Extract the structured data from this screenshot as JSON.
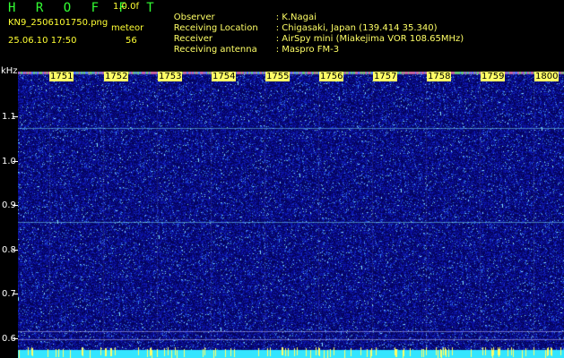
{
  "header": {
    "logo": "H R O F F T",
    "version": "1.0.0f",
    "filename": "KN9_2506101750.png",
    "datetime": "25.06.10 17:50",
    "meteor_label": "meteor",
    "meteor_count": "56",
    "info": [
      {
        "key": "Observer",
        "value": ": K.Nagai"
      },
      {
        "key": "Receiving Location",
        "value": ": Chigasaki, Japan (139.414 35.340)"
      },
      {
        "key": "Receiver",
        "value": ": AirSpy mini (Miakejima VOR 108.65MHz)"
      },
      {
        "key": "Receiving antenna",
        "value": ": Maspro FM-3"
      }
    ]
  },
  "axis": {
    "y_unit": "kHz",
    "y_ticks": [
      "1.1",
      "1.0",
      "0.9",
      "0.8",
      "0.7",
      "0.6"
    ],
    "x_ticks": [
      "1751",
      "1752",
      "1753",
      "1754",
      "1755",
      "1756",
      "1757",
      "1758",
      "1759",
      "1800"
    ]
  },
  "colors": {
    "background": "#000000",
    "waterfall_base": "#0a0a8c",
    "text_yellow": "#ffff33",
    "logo_green": "#33ff33",
    "bottom_band": "#33e5ff"
  }
}
